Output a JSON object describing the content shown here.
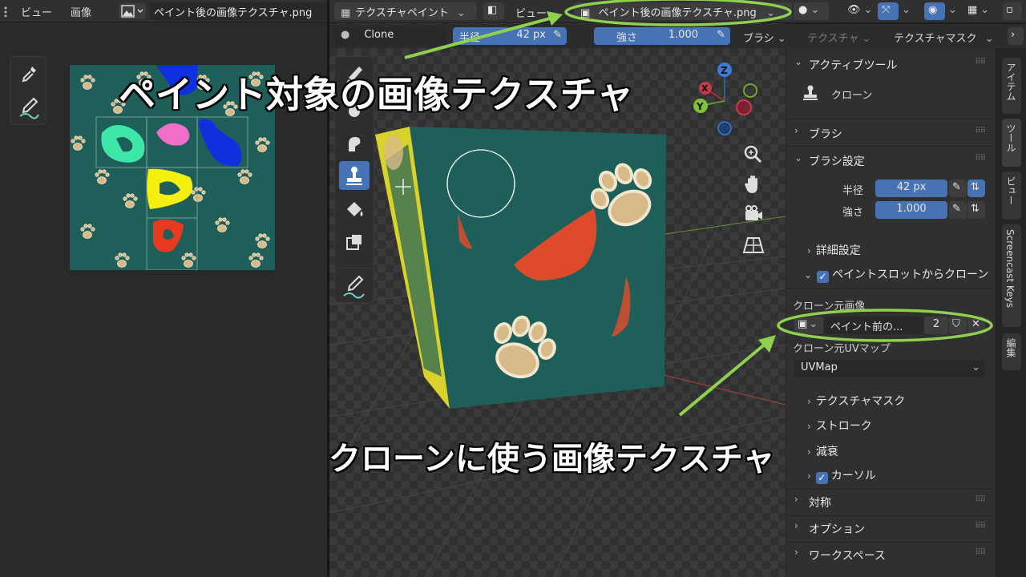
{
  "image_editor": {
    "menu": {
      "view": "ビュー",
      "image": "画像"
    },
    "image_name": "ペイント後の画像テクスチャ.png",
    "tools": [
      "eyedropper-tool",
      "annotate-tool"
    ]
  },
  "viewport_header": {
    "mode": "テクスチャペイント",
    "view": "ビュー",
    "image_name": "ペイント後の画像テクスチャ.png"
  },
  "tool_header": {
    "brush_name": "Clone",
    "radius_label": "半径",
    "radius_value": "42 px",
    "strength_label": "強さ",
    "strength_value": "1.000",
    "brush_menu": "ブラシ",
    "texture_menu": "テクスチャ",
    "texture_mask_menu": "テクスチャマスク"
  },
  "sidebar": {
    "active_tool": {
      "title": "アクティブツール",
      "tool_name": "クローン"
    },
    "brush": {
      "title": "ブラシ"
    },
    "brush_settings": {
      "title": "ブラシ設定",
      "radius_label": "半径",
      "radius_value": "42 px",
      "strength_label": "強さ",
      "strength_value": "1.000",
      "advanced": "詳細設定",
      "clone_from_paint_slot": "ペイントスロットからクローン",
      "clone_from_paint_slot_checked": true,
      "source_image_label": "クローン元画像",
      "source_image_name": "ペイント前の...",
      "source_image_users": "2",
      "source_uv_label": "クローン元UVマップ",
      "source_uv_value": "UVMap",
      "texture_mask": "テクスチャマスク",
      "stroke": "ストローク",
      "falloff": "減衰",
      "cursor": "カーソル",
      "cursor_checked": true
    },
    "symmetry": {
      "title": "対称"
    },
    "options": {
      "title": "オプション"
    },
    "workspace": {
      "title": "ワークスペース"
    }
  },
  "side_tabs": [
    "アイテム",
    "ツール",
    "ビュー",
    "Screencast Keys",
    "編集"
  ],
  "annotations": {
    "top": "ペイント対象の画像テクスチャ",
    "bottom": "クローンに使う画像テクスチャ"
  },
  "colors": {
    "accent": "#4772b3",
    "highlight": "#8fd14f",
    "texture_bg": "#1f5f5a",
    "paw": "#d8b98a",
    "red_paint": "#e84a28"
  }
}
